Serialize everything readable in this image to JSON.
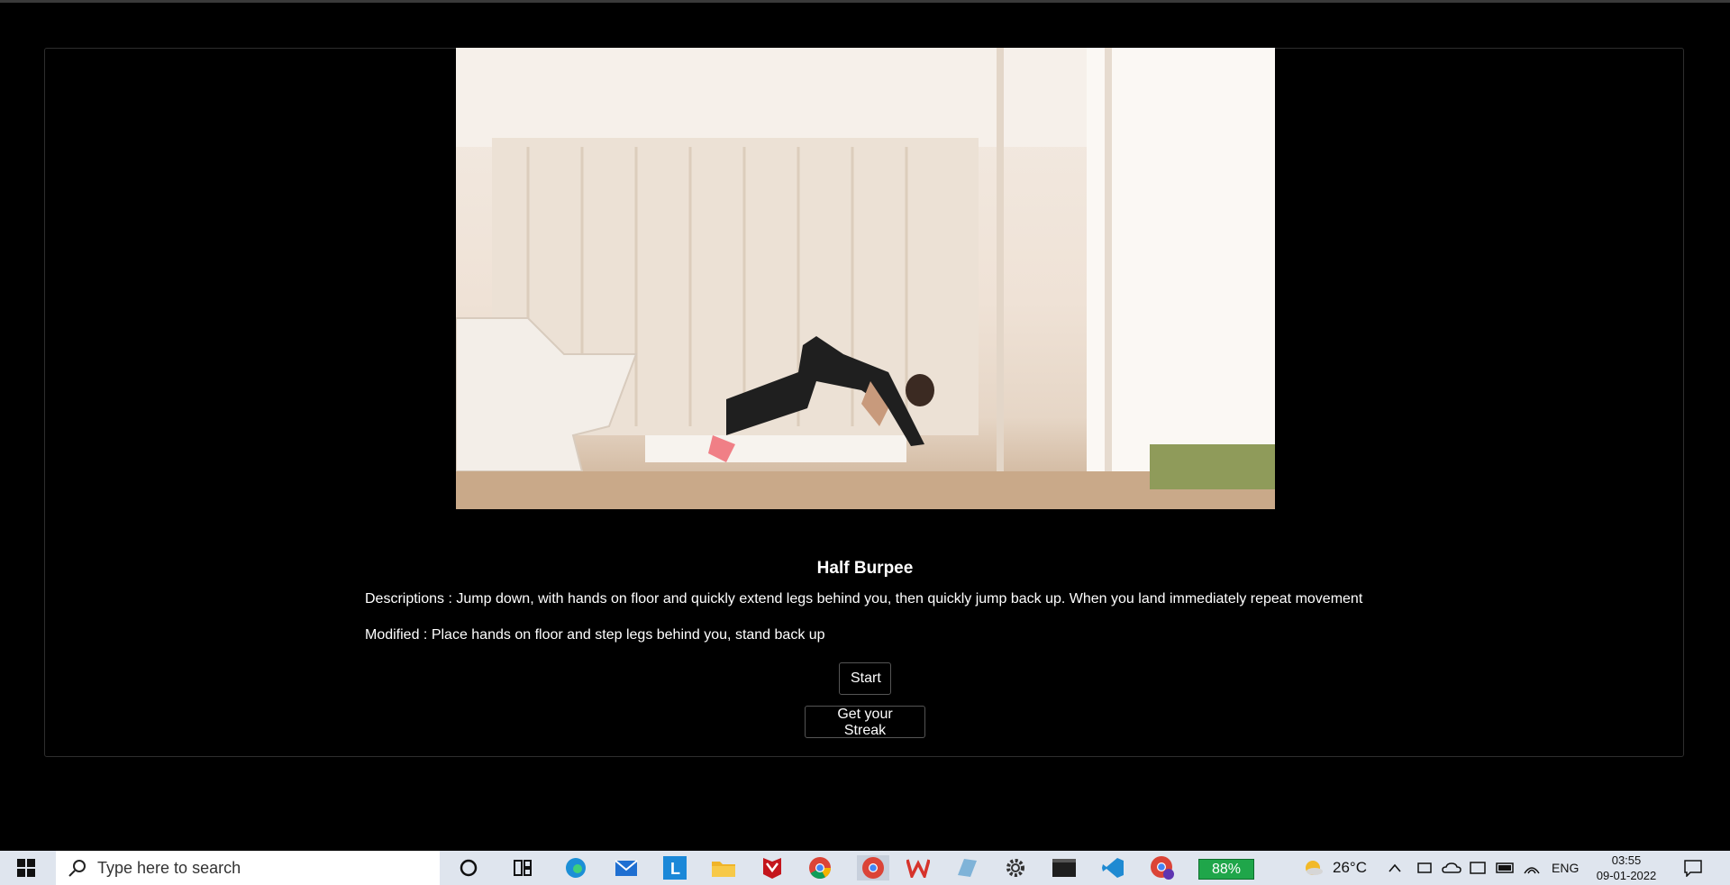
{
  "exercise": {
    "title": "Half Burpee",
    "description": "Descriptions : Jump down, with hands on floor and quickly extend legs behind you, then quickly jump back up. When you land immediately repeat movement",
    "modified": "Modified : Place hands on floor and step legs behind you, stand back up"
  },
  "buttons": {
    "start": "Start",
    "streak": "Get your Streak"
  },
  "taskbar": {
    "search_placeholder": "Type here to search",
    "battery": "88%",
    "weather": "26°C",
    "language": "ENG",
    "time": "03:55",
    "date": "09-01-2022"
  }
}
